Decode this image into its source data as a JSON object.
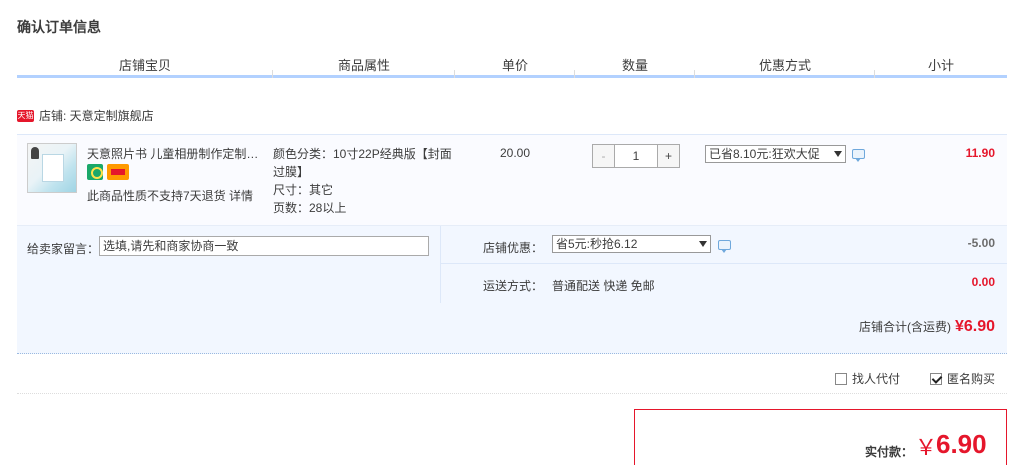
{
  "page": {
    "title": "确认订单信息"
  },
  "columns": [
    "店铺宝贝",
    "商品属性",
    "单价",
    "数量",
    "优惠方式",
    "小计"
  ],
  "shop": {
    "badge": "天猫",
    "label": "店铺: 天意定制旗舰店"
  },
  "item": {
    "title": "天意照片书 儿童相册制作定制毕业纪念册宝宝影集",
    "notice": "此商品性质不支持7天退货 详情",
    "attributes": [
      "颜色分类：10寸22P经典版【封面过膜】",
      "尺寸：其它",
      "页数：28以上"
    ],
    "price": "20.00",
    "quantity": {
      "minus": "-",
      "value": "1",
      "plus": "+"
    },
    "promotion": "已省8.10元:狂欢大促",
    "subtotal": "11.90",
    "icons": [
      "product-thumbnail",
      "service-icon-green",
      "service-icon-orange",
      "chat-icon"
    ]
  },
  "message": {
    "label": "给卖家留言：",
    "placeholder": "选填,请先和商家协商一致"
  },
  "shop_discount": {
    "label": "店铺优惠：",
    "selected": "省5元:秒抢6.12",
    "amount": "-5.00"
  },
  "shipping": {
    "label": "运送方式：",
    "value": "普通配送 快递 免邮",
    "amount": "0.00"
  },
  "shop_total": {
    "label": "店铺合计(含运费)",
    "value": "¥6.90"
  },
  "options": {
    "proxy": {
      "label": "找人代付",
      "checked": false
    },
    "anonymous": {
      "label": "匿名购买",
      "checked": true
    }
  },
  "payment": {
    "label": "实付款：",
    "currency": "￥",
    "value": "6.90"
  },
  "colors": {
    "accent_red": "#e5162b",
    "header_blue": "#b2d1ff",
    "panel_blue": "#f2f7ff"
  }
}
